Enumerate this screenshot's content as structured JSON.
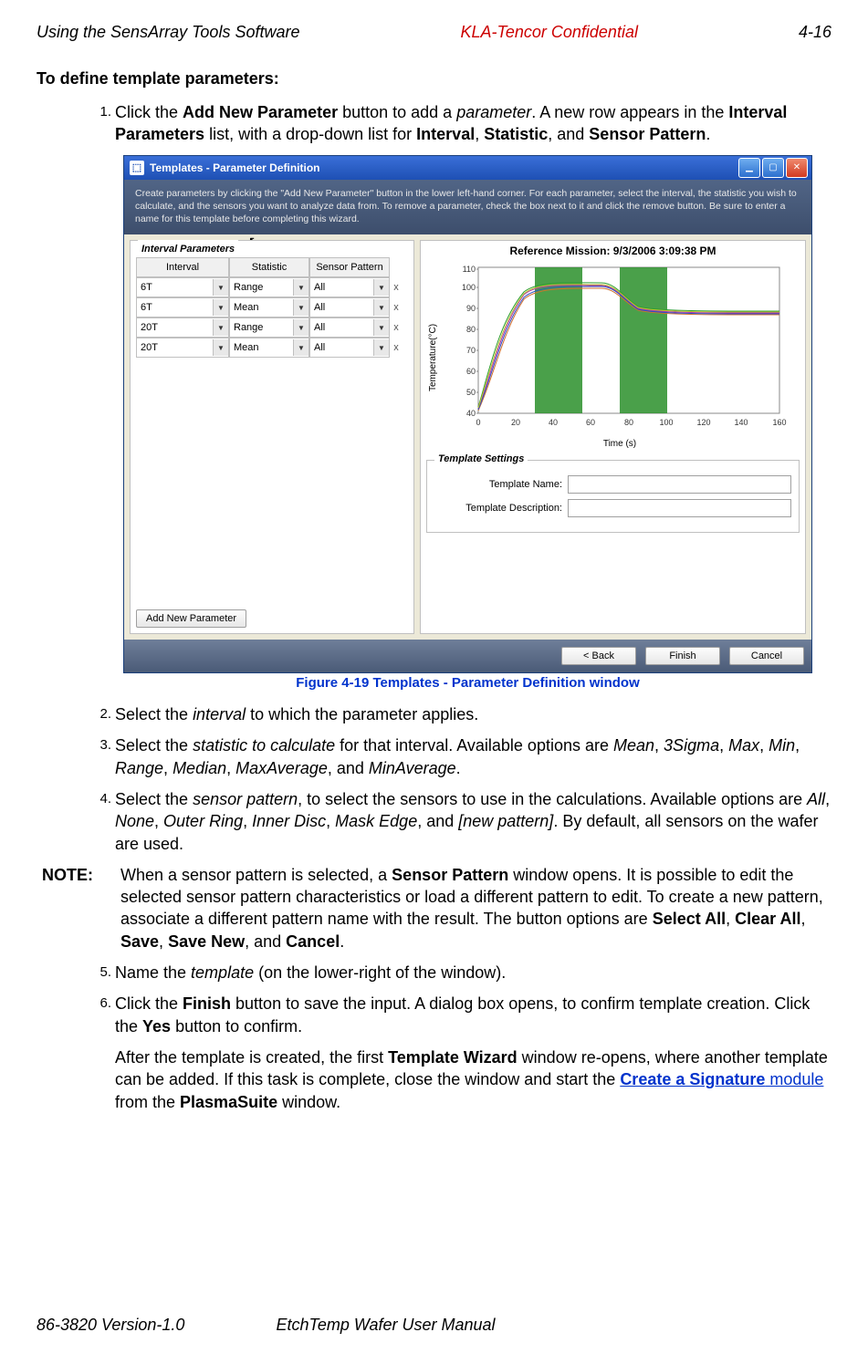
{
  "header": {
    "left": "Using the SensArray Tools Software",
    "center": "KLA-Tencor Confidential",
    "right": "4-16"
  },
  "footer": {
    "version": "86-3820 Version-1.0",
    "manual": "EtchTemp Wafer User Manual"
  },
  "section_heading": "To define template parameters:",
  "steps": {
    "s1": {
      "num": "1.",
      "pre": "Click the ",
      "btn": "Add New Parameter",
      "mid1": " button to add a ",
      "param": "parameter",
      "mid2": ". A new row appears in the ",
      "ip": "Interval Parameters",
      "mid3": " list, with a drop-down list for ",
      "k1": "Interval",
      "c1": ", ",
      "k2": "Statistic",
      "c2": ", and ",
      "k3": "Sensor Pattern",
      "end": "."
    },
    "s2": {
      "num": "2.",
      "pre": "Select the ",
      "it": "interval",
      "post": " to which the parameter applies."
    },
    "s3": {
      "num": "3.",
      "pre": "Select the ",
      "it": "statistic to calculate",
      "mid": " for that interval. Available options are ",
      "o1": "Mean",
      "c1": ", ",
      "o2": "3Sigma",
      "c2": ", ",
      "o3": "Max",
      "c3": ", ",
      "o4": "Min",
      "c4": ", ",
      "o5": "Range",
      "c5": ", ",
      "o6": "Median",
      "c6": ", ",
      "o7": "MaxAverage",
      "c7": ", and ",
      "o8": "MinAverage",
      "end": "."
    },
    "s4": {
      "num": "4.",
      "pre": "Select the ",
      "it": "sensor pattern",
      "mid": ", to select the sensors to use in the calculations. Available options are ",
      "o1": "All",
      "c1": ", ",
      "o2": "None",
      "c2": ", ",
      "o3": "Outer Ring",
      "c3": ", ",
      "o4": "Inner Disc",
      "c4": ", ",
      "o5": "Mask Edge",
      "c5": ", and ",
      "o6": "[new pattern]",
      "end": ". By default, all sensors on the wafer are used."
    },
    "s5": {
      "num": "5.",
      "pre": "Name the ",
      "it": "template",
      "post": " (on the lower-right of the window)."
    },
    "s6": {
      "num": "6.",
      "pre": "Click the ",
      "b1": "Finish",
      "mid": " button to save the input. A dialog box opens, to confirm template creation. Click the ",
      "b2": "Yes",
      "post": " button to confirm."
    }
  },
  "note": {
    "label": "NOTE:",
    "pre": " When a sensor pattern is selected, a ",
    "sp": "Sensor Pattern",
    "mid": " window opens. It is possible to edit the selected sensor pattern characteristics or load a different pattern to edit. To create a new pattern, associate a different pattern name with the result. The button options are ",
    "b1": "Select All",
    "c1": ", ",
    "b2": "Clear All",
    "c2": ", ",
    "b3": "Save",
    "c3": ", ",
    "b4": "Save New",
    "c4": ", and ",
    "b5": "Cancel",
    "end": "."
  },
  "after": {
    "pre": "After the template is created, the first ",
    "tw": "Template Wizard",
    "mid": " window re-opens, where another template can be added. If this task is complete, close the window and start the ",
    "link": "Create a Signature",
    "linkpost": " module",
    "mid2": " from the ",
    "ps": "PlasmaSuite",
    "end": " window."
  },
  "figure_caption": "Figure 4-19 Templates - Parameter Definition window",
  "window": {
    "title": "Templates - Parameter Definition",
    "banner": "Create parameters by clicking the \"Add New Parameter\" button in the lower left-hand corner.  For each parameter, select the interval, the statistic you wish to calculate, and the sensors you want to analyze data from. To remove a parameter, check the box next to it and click the remove button.  Be sure to enter a name for this template before completing this wizard.",
    "interval_params_label": "Interval Parameters",
    "columns": {
      "interval": "Interval",
      "statistic": "Statistic",
      "pattern": "Sensor Pattern"
    },
    "rows": [
      {
        "interval": "6T",
        "statistic": "Range",
        "pattern": "All"
      },
      {
        "interval": "6T",
        "statistic": "Mean",
        "pattern": "All"
      },
      {
        "interval": "20T",
        "statistic": "Range",
        "pattern": "All"
      },
      {
        "interval": "20T",
        "statistic": "Mean",
        "pattern": "All"
      }
    ],
    "add_button": "Add New Parameter",
    "reference_mission": "Reference Mission: 9/3/2006 3:09:38 PM",
    "yaxis": "Temperature(°C)",
    "xaxis": "Time (s)",
    "template_settings_label": "Template Settings",
    "template_name_label": "Template Name:",
    "template_desc_label": "Template Description:",
    "template_name_value": "",
    "template_desc_value": "",
    "back": "< Back",
    "finish": "Finish",
    "cancel": "Cancel"
  },
  "chart_data": {
    "type": "line",
    "title": "Reference Mission: 9/3/2006 3:09:38 PM",
    "xlabel": "Time (s)",
    "ylabel": "Temperature(°C)",
    "xlim": [
      0,
      160
    ],
    "ylim": [
      40,
      110
    ],
    "xticks": [
      0,
      20,
      40,
      60,
      80,
      100,
      120,
      140,
      160
    ],
    "yticks": [
      40,
      50,
      60,
      70,
      80,
      90,
      100,
      110
    ],
    "highlight_intervals": [
      [
        30,
        55
      ],
      [
        75,
        100
      ]
    ],
    "series": [
      {
        "name": "sensor-bundle",
        "x": [
          0,
          10,
          20,
          30,
          40,
          55,
          70,
          75,
          80,
          90,
          100,
          120,
          140,
          160
        ],
        "y": [
          42,
          55,
          75,
          92,
          98,
          100,
          100,
          100,
          95,
          90,
          90,
          90,
          90,
          90
        ]
      }
    ]
  }
}
